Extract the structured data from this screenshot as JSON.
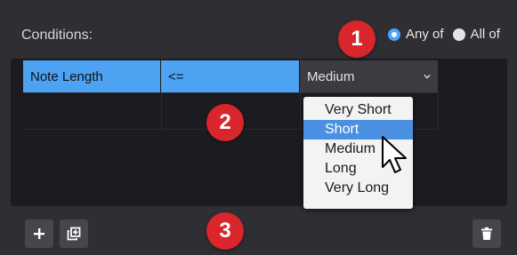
{
  "conditions": {
    "label": "Conditions:",
    "match_options": [
      {
        "label": "Any of",
        "selected": true
      },
      {
        "label": "All of",
        "selected": false
      }
    ]
  },
  "table": {
    "rows": [
      {
        "field": "Note Length",
        "operator": "<=",
        "value": "Medium"
      }
    ]
  },
  "dropdown": {
    "options": [
      "Very Short",
      "Short",
      "Medium",
      "Long",
      "Very Long"
    ],
    "highlighted": "Short"
  },
  "callouts": [
    "1",
    "2",
    "3"
  ],
  "toolbar": {
    "add_icon": "plus-icon",
    "duplicate_icon": "duplicate-icon",
    "delete_icon": "trash-icon"
  },
  "colors": {
    "accent": "#4da3f2",
    "callout": "#d8262c",
    "selection": "#4a90e2"
  }
}
